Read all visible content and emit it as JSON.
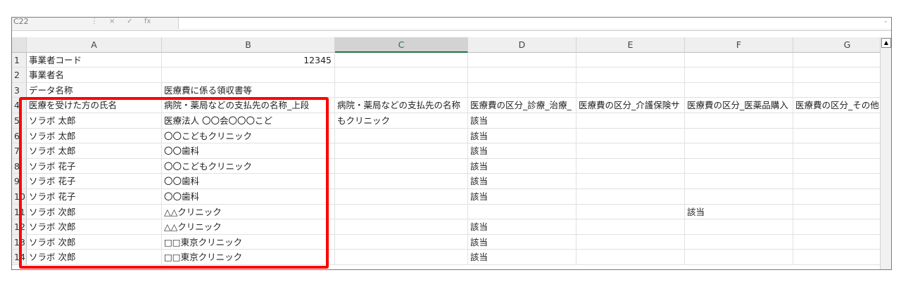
{
  "formula_bar": {
    "name_box": "C22",
    "icons": [
      "⋮",
      "×",
      "✓"
    ],
    "fx": "fx"
  },
  "columns": [
    "A",
    "B",
    "C",
    "D",
    "E",
    "F",
    "G"
  ],
  "selected_column": "C",
  "rows": [
    {
      "num": "1",
      "A": "事業者コード",
      "B": "12345",
      "C": "",
      "D": "",
      "E": "",
      "F": "",
      "G": ""
    },
    {
      "num": "2",
      "A": "事業者名",
      "B": "",
      "C": "",
      "D": "",
      "E": "",
      "F": "",
      "G": ""
    },
    {
      "num": "3",
      "A": "データ名称",
      "B": "医療費に係る領収書等",
      "C": "",
      "D": "",
      "E": "",
      "F": "",
      "G": ""
    },
    {
      "num": "4",
      "A": "医療を受けた方の氏名",
      "B": "病院・薬局などの支払先の名称_上段",
      "C": "病院・薬局などの支払先の名称",
      "D": "医療費の区分_診療_治療_",
      "E": "医療費の区分_介護保険サ",
      "F": "医療費の区分_医薬品購入",
      "G": "医療費の区分_その他"
    },
    {
      "num": "5",
      "A": "ソラボ 太郎",
      "B": "医療法人 〇〇会〇〇〇こど",
      "C": "もクリニック",
      "D": "該当",
      "E": "",
      "F": "",
      "G": ""
    },
    {
      "num": "6",
      "A": "ソラボ 太郎",
      "B": "〇〇こどもクリニック",
      "C": "",
      "D": "該当",
      "E": "",
      "F": "",
      "G": ""
    },
    {
      "num": "7",
      "A": "ソラボ 太郎",
      "B": "〇〇歯科",
      "C": "",
      "D": "該当",
      "E": "",
      "F": "",
      "G": ""
    },
    {
      "num": "8",
      "A": "ソラボ 花子",
      "B": "〇〇こどもクリニック",
      "C": "",
      "D": "該当",
      "E": "",
      "F": "",
      "G": ""
    },
    {
      "num": "9",
      "A": "ソラボ 花子",
      "B": "〇〇歯科",
      "C": "",
      "D": "該当",
      "E": "",
      "F": "",
      "G": ""
    },
    {
      "num": "10",
      "A": "ソラボ 花子",
      "B": "〇〇歯科",
      "C": "",
      "D": "該当",
      "E": "",
      "F": "",
      "G": ""
    },
    {
      "num": "11",
      "A": "ソラボ 次郎",
      "B": "△△クリニック",
      "C": "",
      "D": "",
      "E": "",
      "F": "該当",
      "G": ""
    },
    {
      "num": "12",
      "A": "ソラボ 次郎",
      "B": "△△クリニック",
      "C": "",
      "D": "該当",
      "E": "",
      "F": "",
      "G": ""
    },
    {
      "num": "13",
      "A": "ソラボ 次郎",
      "B": "□□東京クリニック",
      "C": "",
      "D": "該当",
      "E": "",
      "F": "",
      "G": ""
    },
    {
      "num": "14",
      "A": "ソラボ 次郎",
      "B": "□□東京クリニック",
      "C": "",
      "D": "該当",
      "E": "",
      "F": "",
      "G": ""
    }
  ],
  "highlight_color": "#ff0000",
  "accent_color": "#217346"
}
